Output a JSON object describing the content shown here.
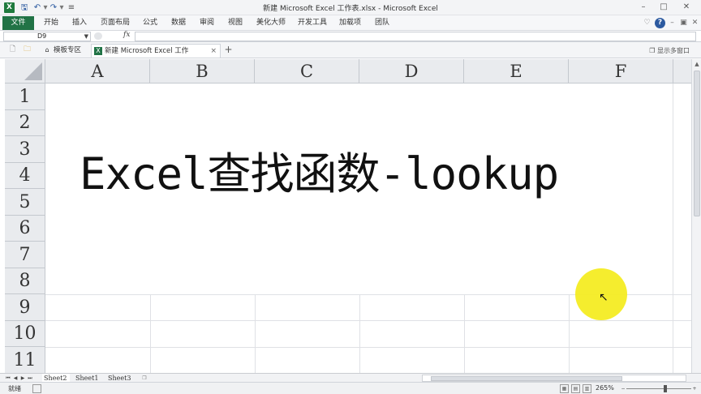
{
  "window": {
    "title": "新建 Microsoft Excel 工作表.xlsx - Microsoft Excel",
    "app_icon": "X"
  },
  "ribbon": {
    "file_tab": "文件",
    "tabs": [
      "开始",
      "插入",
      "页面布局",
      "公式",
      "数据",
      "审阅",
      "视图",
      "美化大师",
      "开发工具",
      "加载项",
      "团队"
    ]
  },
  "formula_bar": {
    "name_box": "D9",
    "fx": "fx",
    "formula_value": ""
  },
  "doc_tabs": {
    "items": [
      {
        "label": "模板专区",
        "icon": "home-icon"
      },
      {
        "label": "新建 Microsoft Excel 工作表.xlsx",
        "icon": "excel-file-icon"
      }
    ],
    "close": "×",
    "add": "+",
    "multi_window": "显示多窗口"
  },
  "grid": {
    "columns": [
      "A",
      "B",
      "C",
      "D",
      "E",
      "F"
    ],
    "rows": [
      "1",
      "2",
      "3",
      "4",
      "5",
      "6",
      "7",
      "8",
      "9",
      "10",
      "11"
    ],
    "content_text": "Excel查找函数-lookup"
  },
  "sheets": {
    "tabs": [
      "Sheet2",
      "Sheet1",
      "Sheet3"
    ],
    "active": "Sheet2"
  },
  "status": {
    "ready": "就绪",
    "zoom": "265%"
  },
  "colors": {
    "file_tab": "#217346",
    "header_bg": "#e9ebee",
    "cursor_highlight": "#f4ec1c"
  }
}
